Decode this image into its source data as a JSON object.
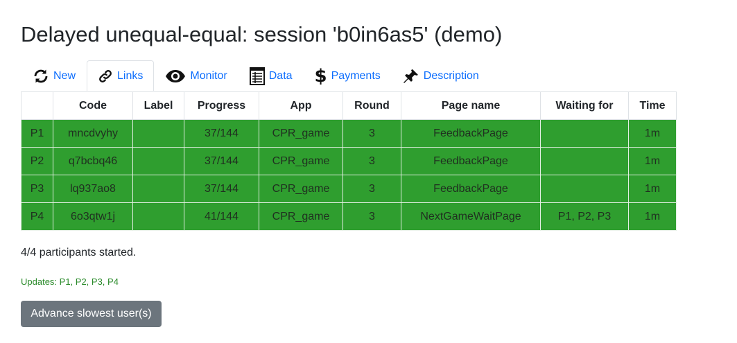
{
  "page": {
    "title": "Delayed unequal-equal: session 'b0in6as5' (demo)"
  },
  "tabs": [
    {
      "label": "New",
      "icon": "refresh-icon"
    },
    {
      "label": "Links",
      "icon": "link-icon",
      "active": true
    },
    {
      "label": "Monitor",
      "icon": "eye-icon"
    },
    {
      "label": "Data",
      "icon": "spreadsheet-icon"
    },
    {
      "label": "Payments",
      "icon": "dollar-icon"
    },
    {
      "label": "Description",
      "icon": "pushpin-icon"
    }
  ],
  "table": {
    "headers": [
      "",
      "Code",
      "Label",
      "Progress",
      "App",
      "Round",
      "Page name",
      "Waiting for",
      "Time"
    ],
    "rows": [
      {
        "id": "P1",
        "code": "mncdvyhy",
        "label": "",
        "progress": "37/144",
        "app": "CPR_game",
        "round": "3",
        "page_name": "FeedbackPage",
        "waiting_for": "",
        "time": "1m"
      },
      {
        "id": "P2",
        "code": "q7bcbq46",
        "label": "",
        "progress": "37/144",
        "app": "CPR_game",
        "round": "3",
        "page_name": "FeedbackPage",
        "waiting_for": "",
        "time": "1m"
      },
      {
        "id": "P3",
        "code": "lq937ao8",
        "label": "",
        "progress": "37/144",
        "app": "CPR_game",
        "round": "3",
        "page_name": "FeedbackPage",
        "waiting_for": "",
        "time": "1m"
      },
      {
        "id": "P4",
        "code": "6o3qtw1j",
        "label": "",
        "progress": "41/144",
        "app": "CPR_game",
        "round": "3",
        "page_name": "NextGameWaitPage",
        "waiting_for": "P1, P2, P3",
        "time": "1m"
      }
    ],
    "row_color": "#2f9e2f"
  },
  "summary": "4/4 participants started.",
  "updates": "Updates: P1, P2, P3, P4",
  "advance_button": "Advance slowest user(s)",
  "colors": {
    "link": "#0d6efd",
    "button": "#6c757d",
    "updates_text": "#2a8a2a"
  }
}
